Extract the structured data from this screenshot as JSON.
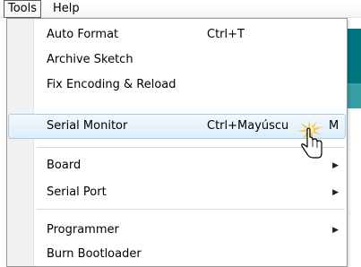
{
  "menubar": {
    "tools_label": "Tools",
    "help_label": "Help"
  },
  "tools_menu": {
    "items": [
      {
        "label": "Auto Format",
        "shortcut": "Ctrl+T"
      },
      {
        "label": "Archive Sketch",
        "shortcut": ""
      },
      {
        "label": "Fix Encoding & Reload",
        "shortcut": ""
      },
      {
        "label": "Serial Monitor",
        "shortcut": "Ctrl+Mayúscu",
        "shortcut_tail": "M"
      },
      {
        "label": "Board",
        "submenu": "▶"
      },
      {
        "label": "Serial Port",
        "submenu": "▶"
      },
      {
        "label": "Programmer",
        "submenu": "▶"
      },
      {
        "label": "Burn Bootloader",
        "shortcut": ""
      }
    ]
  },
  "colors": {
    "highlight_border": "#a9cde9",
    "editor_teal": "#00747f",
    "editor_teal_light": "#3a9ea5"
  },
  "cursor": {
    "icon": "pointer-hand-icon-with-click-flash"
  }
}
